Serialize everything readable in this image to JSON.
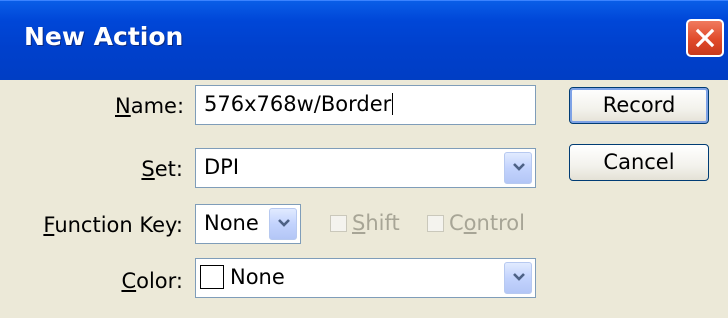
{
  "window": {
    "title": "New Action"
  },
  "form": {
    "name_label_u": "N",
    "name_label_rest": "ame:",
    "name_value": "576x768w/Border",
    "set_label_u": "S",
    "set_label_rest": "et:",
    "set_value": "DPI",
    "fkey_label_u": "F",
    "fkey_label_rest": "unction Key:",
    "fkey_value": "None",
    "shift_label_u": "S",
    "shift_label_rest": "hift",
    "control_label_pre": "C",
    "control_label_u": "o",
    "control_label_rest": "ntrol",
    "color_label_u": "C",
    "color_label_rest": "olor:",
    "color_value": "None"
  },
  "buttons": {
    "record": "Record",
    "cancel": "Cancel"
  },
  "colors": {
    "title_bar": "#0047d8",
    "dialog_bg": "#ece9d8",
    "close_button": "#e04a2a"
  },
  "icons": {
    "close": "close-icon",
    "dropdown": "chevron-down-icon"
  }
}
